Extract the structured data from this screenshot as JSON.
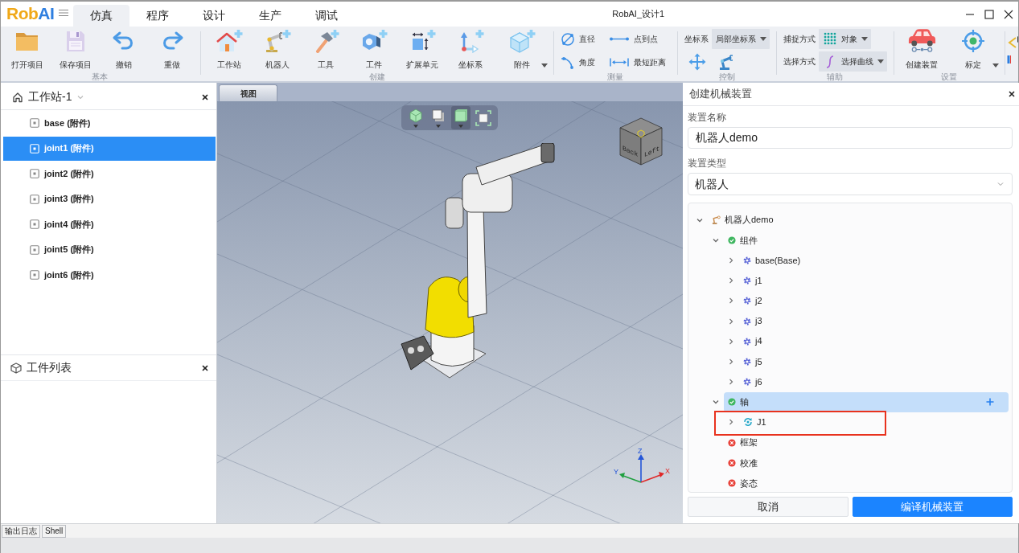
{
  "window": {
    "logo": [
      "Rob",
      "AI"
    ],
    "title": "RobAI_设计1"
  },
  "tabs": [
    {
      "label": "仿真",
      "selected": true
    },
    {
      "label": "程序",
      "selected": false
    },
    {
      "label": "设计",
      "selected": false
    },
    {
      "label": "生产",
      "selected": false
    },
    {
      "label": "调试",
      "selected": false
    }
  ],
  "ribbon": [
    {
      "label": "基本",
      "items": [
        {
          "kind": "large",
          "label": "打开项目"
        },
        {
          "kind": "large",
          "label": "保存项目"
        },
        {
          "kind": "large",
          "label": "撤销"
        },
        {
          "kind": "large",
          "label": "重做"
        }
      ]
    },
    {
      "label": "创建",
      "items": [
        {
          "kind": "large",
          "label": "工作站"
        },
        {
          "kind": "large",
          "label": "机器人"
        },
        {
          "kind": "large",
          "label": "工具"
        },
        {
          "kind": "large",
          "label": "工件"
        },
        {
          "kind": "large",
          "label": "扩展单元"
        },
        {
          "kind": "large",
          "label": "坐标系"
        },
        {
          "kind": "large_menu",
          "label": "附件"
        }
      ]
    },
    {
      "label": "测量",
      "items": [
        {
          "kind": "small",
          "label": "直径"
        },
        {
          "kind": "small",
          "label": "点到点"
        },
        {
          "kind": "small",
          "label": "角度"
        },
        {
          "kind": "small",
          "label": "最短距离"
        }
      ]
    },
    {
      "label": "控制",
      "items": [
        {
          "kind": "combo",
          "label": "坐标系",
          "value": "局部坐标系"
        },
        {
          "kind": "icon"
        },
        {
          "kind": "icon"
        }
      ]
    },
    {
      "label": "辅助",
      "items": [
        {
          "kind": "combo",
          "label": "捕捉方式",
          "value": "对象"
        },
        {
          "kind": "combo",
          "label": "选择方式",
          "value": "选择曲线"
        }
      ]
    },
    {
      "label": "设置",
      "items": [
        {
          "kind": "large",
          "label": "创建装置"
        },
        {
          "kind": "large_menu",
          "label": "标定"
        }
      ]
    }
  ],
  "station_panel": {
    "title": "工作站-1",
    "items": [
      {
        "label": "base (附件)",
        "selected": false
      },
      {
        "label": "joint1 (附件)",
        "selected": true
      },
      {
        "label": "joint2 (附件)",
        "selected": false
      },
      {
        "label": "joint3 (附件)",
        "selected": false
      },
      {
        "label": "joint4 (附件)",
        "selected": false
      },
      {
        "label": "joint5 (附件)",
        "selected": false
      },
      {
        "label": "joint6 (附件)",
        "selected": false
      }
    ]
  },
  "parts_panel": {
    "title": "工件列表"
  },
  "viewport": {
    "tab": "视图",
    "tools": [
      {
        "kind": "menu",
        "selected": false
      },
      {
        "kind": "menu",
        "selected": false
      },
      {
        "kind": "menu",
        "selected": true
      },
      {
        "kind": "button",
        "selected": false
      }
    ],
    "cube_faces": [
      "Back",
      "Left"
    ],
    "axes": [
      "X",
      "Y",
      "Z"
    ]
  },
  "device_panel": {
    "title": "创建机械装置",
    "fields": [
      {
        "kind": "text",
        "label": "装置名称",
        "value": "机器人demo"
      },
      {
        "kind": "select",
        "label": "装置类型",
        "value": "机器人"
      }
    ],
    "tree": [
      {
        "label": "机器人demo",
        "kind": "device",
        "expanded": true,
        "selected": false,
        "children": [
          {
            "label": "组件",
            "kind": "group",
            "complete": true,
            "expanded": true,
            "selected": false,
            "children": [
              {
                "label": "base(Base)",
                "kind": "part",
                "expanded": false,
                "selected": false
              },
              {
                "label": "j1",
                "kind": "part",
                "expanded": false,
                "selected": false
              },
              {
                "label": "j2",
                "kind": "part",
                "expanded": false,
                "selected": false
              },
              {
                "label": "j3",
                "kind": "part",
                "expanded": false,
                "selected": false
              },
              {
                "label": "j4",
                "kind": "part",
                "expanded": false,
                "selected": false
              },
              {
                "label": "j5",
                "kind": "part",
                "expanded": false,
                "selected": false
              },
              {
                "label": "j6",
                "kind": "part",
                "expanded": false,
                "selected": false
              }
            ]
          },
          {
            "label": "轴",
            "kind": "group",
            "complete": true,
            "expanded": true,
            "selected": true,
            "children": [
              {
                "label": "J1",
                "kind": "axis",
                "expanded": false,
                "selected": false,
                "annotated": true
              }
            ]
          },
          {
            "label": "框架",
            "kind": "group",
            "complete": false,
            "selected": false
          },
          {
            "label": "校准",
            "kind": "group",
            "complete": false,
            "selected": false
          },
          {
            "label": "姿态",
            "kind": "group",
            "complete": false,
            "selected": false
          }
        ]
      }
    ],
    "buttons": [
      {
        "kind": "secondary",
        "label": "取消"
      },
      {
        "kind": "primary",
        "label": "编译机械装置"
      }
    ]
  },
  "bottom_tabs": [
    {
      "label": "输出日志",
      "selected": false
    },
    {
      "label": "Shell",
      "selected": false
    }
  ]
}
